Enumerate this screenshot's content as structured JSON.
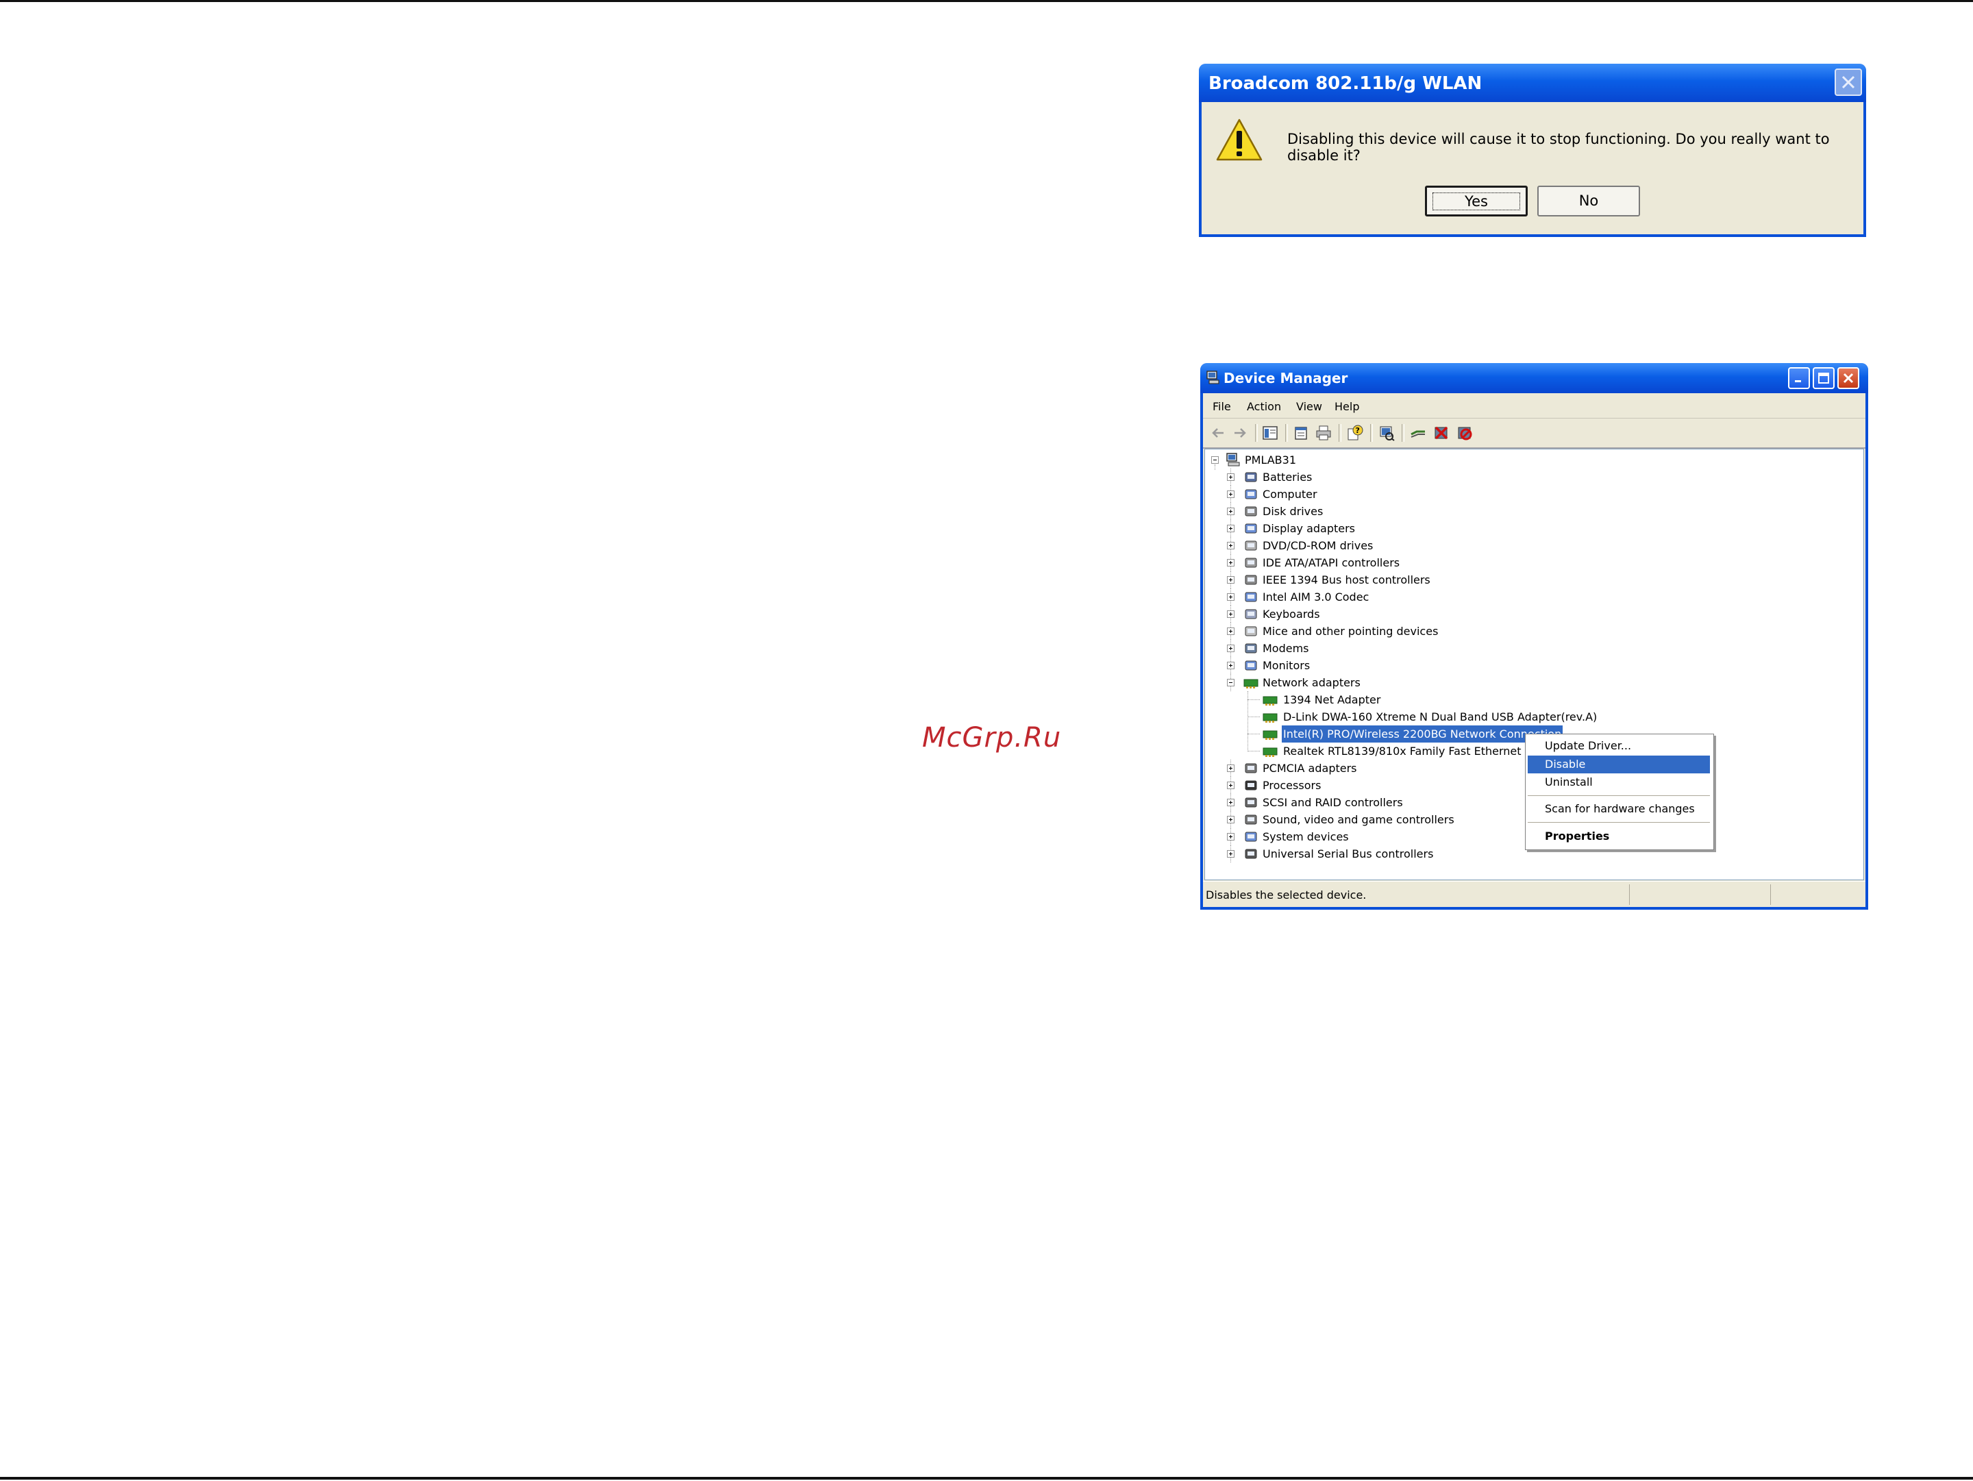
{
  "watermark": "McGrp.Ru",
  "dialog": {
    "title": "Broadcom 802.11b/g WLAN",
    "message": "Disabling this device will cause it to stop functioning. Do you really want to disable it?",
    "yes_label": "Yes",
    "no_label": "No"
  },
  "device_manager": {
    "title": "Device Manager",
    "menu": [
      "File",
      "Action",
      "View",
      "Help"
    ],
    "tree": {
      "root": "PMLAB31",
      "categories": [
        "Batteries",
        "Computer",
        "Disk drives",
        "Display adapters",
        "DVD/CD-ROM drives",
        "IDE ATA/ATAPI controllers",
        "IEEE 1394 Bus host controllers",
        "Intel AIM 3.0 Codec",
        "Keyboards",
        "Mice and other pointing devices",
        "Modems",
        "Monitors",
        "Network adapters",
        "PCMCIA adapters",
        "Processors",
        "SCSI and RAID controllers",
        "Sound, video and game controllers",
        "System devices",
        "Universal Serial Bus controllers"
      ],
      "network_adapters": [
        "1394 Net Adapter",
        "D-Link DWA-160 Xtreme N Dual Band USB Adapter(rev.A)",
        "Intel(R) PRO/Wireless 2200BG Network Connection",
        "Realtek RTL8139/810x Family Fast Ethernet NIC"
      ]
    },
    "status_text": "Disables the selected device."
  },
  "context_menu": {
    "update_driver": "Update Driver...",
    "disable": "Disable",
    "uninstall": "Uninstall",
    "scan": "Scan for hardware changes",
    "properties": "Properties"
  }
}
